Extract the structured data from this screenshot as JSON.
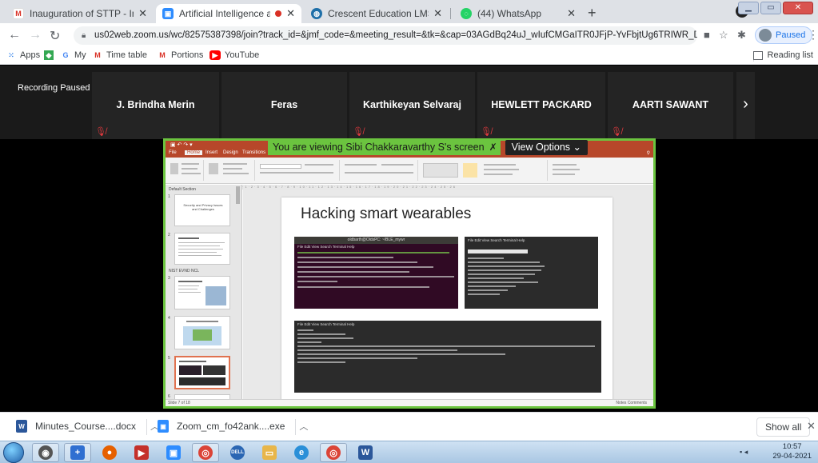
{
  "browser": {
    "tabs": [
      {
        "title": "Inauguration of STTP - Invitation",
        "favicon": "gmail-icon",
        "active": false
      },
      {
        "title": "Artificial Intelligence and its",
        "favicon": "zoom-icon",
        "active": true,
        "recording": true
      },
      {
        "title": "Crescent Education LMS",
        "favicon": "lms-icon",
        "active": false
      },
      {
        "title": "(44) WhatsApp",
        "favicon": "whatsapp-icon",
        "active": false
      }
    ],
    "new_tab_label": "+",
    "url": "us02web.zoom.us/wc/82575387398/join?track_id=&jmf_code=&meeting_result=&tk=&cap=03AGdBq24uJ_wIufCMGaITR0JFjP-YvFbjtUg6TRIWR_DCj9yJbhb...",
    "profile_status": "Paused",
    "bookmarks": [
      {
        "label": "Apps",
        "icon": "apps-grid-icon"
      },
      {
        "label": "",
        "icon": "maps-icon"
      },
      {
        "label": "",
        "icon": "google-icon"
      },
      {
        "label": "My",
        "icon": ""
      },
      {
        "label": "Time table",
        "icon": "gmail-icon"
      },
      {
        "label": "Portions",
        "icon": "gmail-icon"
      },
      {
        "label": "YouTube",
        "icon": "youtube-icon"
      }
    ],
    "reading_list": "Reading list"
  },
  "meeting": {
    "recording_status": "Recording Paused",
    "participants": [
      "J. Brindha Merin",
      "Feras",
      "Karthikeyan Selvaraj",
      "HEWLETT PACKARD",
      "AARTI SAWANT"
    ],
    "viewing_banner": "You are viewing Sibi Chakkaravarthy S's screen",
    "view_options": "View Options",
    "view_options_caret": "⌄"
  },
  "presentation": {
    "ribbon_tabs": [
      "File",
      "Home",
      "Insert",
      "Design",
      "Transitions"
    ],
    "slide_title": "Hacking smart wearables",
    "terminal1_title": "oldbarth@OldsPC: ~/BLE_mywr",
    "terminal2_menu": "File  Edit  View  Search  Terminal  Help",
    "terminal1_menu": "File  Edit  View  Search  Terminal  Help",
    "terminal3_menu": "File  Edit  View  Search  Terminal  Help",
    "thumb1_text": "Security and Privacy Issues and Challenges",
    "section1": "Default Section",
    "section2": "NIST EVND NCL",
    "status_left": "Slide 7 of 18",
    "status_right": "Notes   Comments"
  },
  "downloads": [
    {
      "name": "Minutes_Course....docx",
      "icon": "word-doc-icon"
    },
    {
      "name": "Zoom_cm_fo42ank....exe",
      "icon": "zoom-installer-icon"
    }
  ],
  "show_all": "Show all",
  "taskbar": {
    "time": "10:57",
    "date": "29-04-2021"
  },
  "colors": {
    "share_border": "#6bc43f",
    "ppt_accent": "#b7472a",
    "muted_mic": "#e0393e",
    "link_blue": "#1a73e8"
  }
}
